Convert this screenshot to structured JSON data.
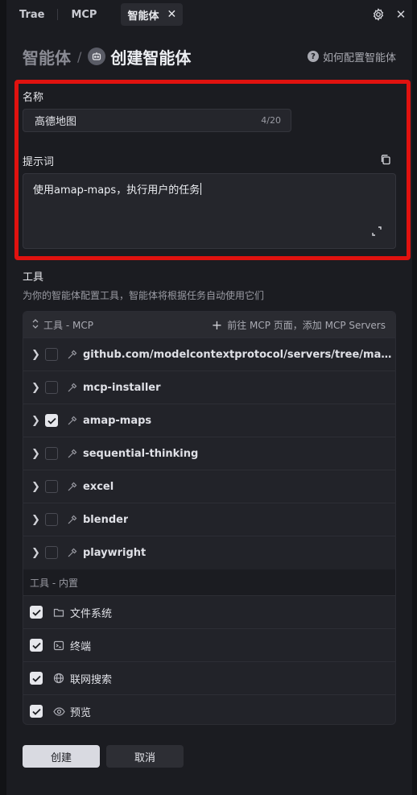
{
  "tabs": [
    {
      "label": "Trae"
    },
    {
      "label": "MCP"
    },
    {
      "label": "智能体",
      "active": true
    }
  ],
  "header": {
    "breadcrumb_root": "智能体",
    "separator": "/",
    "title": "创建智能体",
    "help_text": "如何配置智能体"
  },
  "form": {
    "name_label": "名称",
    "name_value": "高德地图",
    "name_count": "4/20",
    "prompt_label": "提示词",
    "prompt_value": "使用amap-maps，执行用户的任务"
  },
  "tools": {
    "title": "工具",
    "description": "为你的智能体配置工具，智能体将根据任务自动使用它们",
    "mcp_header": "工具 - MCP",
    "add_mcp_link": "前往 MCP 页面，添加 MCP Servers",
    "mcp_items": [
      {
        "name": "github.com/modelcontextprotocol/servers/tree/main/src/filesystem",
        "checked": false
      },
      {
        "name": "mcp-installer",
        "checked": false
      },
      {
        "name": "amap-maps",
        "checked": true
      },
      {
        "name": "sequential-thinking",
        "checked": false
      },
      {
        "name": "excel",
        "checked": false
      },
      {
        "name": "blender",
        "checked": false
      },
      {
        "name": "playwright",
        "checked": false
      }
    ],
    "builtin_header": "工具 - 内置",
    "builtin_items": [
      {
        "name": "文件系统",
        "icon": "folder-icon",
        "checked": true
      },
      {
        "name": "终端",
        "icon": "terminal-icon",
        "checked": true
      },
      {
        "name": "联网搜索",
        "icon": "globe-icon",
        "checked": true
      },
      {
        "name": "预览",
        "icon": "eye-icon",
        "checked": true
      }
    ]
  },
  "actions": {
    "create_label": "创建",
    "cancel_label": "取消"
  },
  "colors": {
    "highlight": "#e0120f",
    "background": "#1b1c21",
    "panel": "#222329"
  }
}
